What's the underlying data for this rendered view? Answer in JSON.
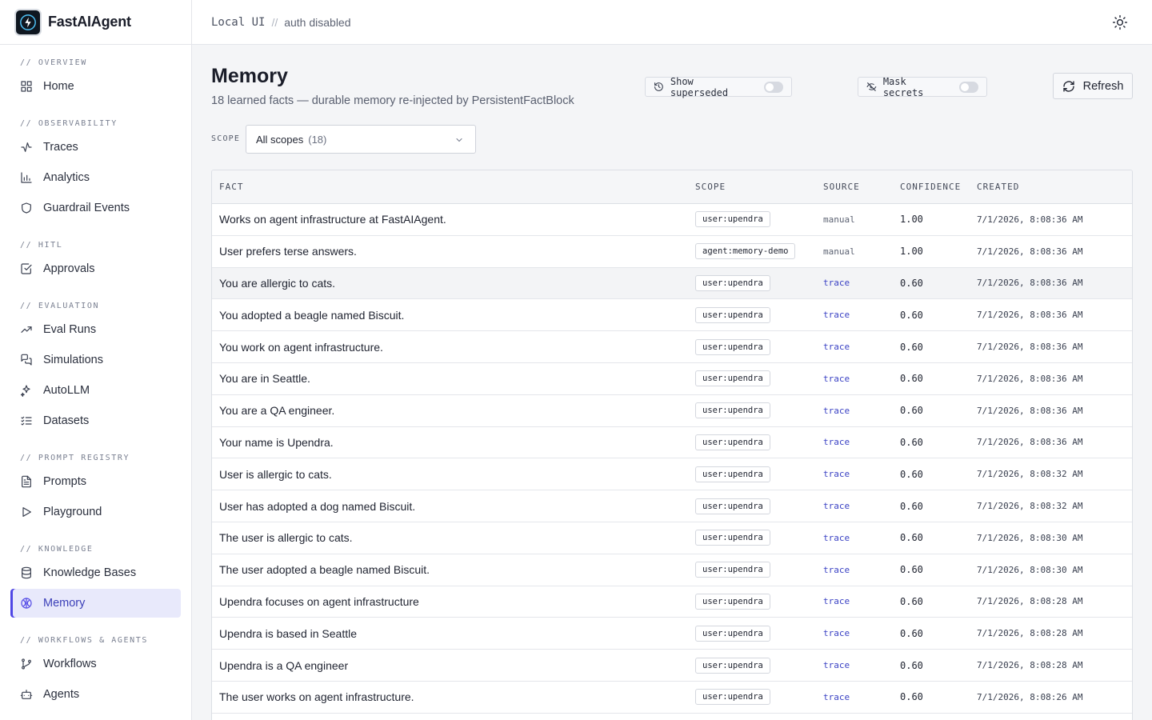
{
  "brand": {
    "name": "FastAIAgent"
  },
  "topbar": {
    "mode": "Local UI",
    "separator": "//",
    "auth": "auth disabled"
  },
  "nav": {
    "sections": [
      {
        "title": "// OVERVIEW",
        "items": [
          {
            "label": "Home",
            "icon": "home-grid-icon"
          }
        ]
      },
      {
        "title": "// OBSERVABILITY",
        "items": [
          {
            "label": "Traces",
            "icon": "activity-icon"
          },
          {
            "label": "Analytics",
            "icon": "bar-chart-icon"
          },
          {
            "label": "Guardrail Events",
            "icon": "shield-icon"
          }
        ]
      },
      {
        "title": "// HITL",
        "items": [
          {
            "label": "Approvals",
            "icon": "check-square-icon"
          }
        ]
      },
      {
        "title": "// EVALUATION",
        "items": [
          {
            "label": "Eval Runs",
            "icon": "trending-up-icon"
          },
          {
            "label": "Simulations",
            "icon": "chat-bubbles-icon"
          },
          {
            "label": "AutoLLM",
            "icon": "sparkles-icon"
          },
          {
            "label": "Datasets",
            "icon": "list-checks-icon"
          }
        ]
      },
      {
        "title": "// PROMPT REGISTRY",
        "items": [
          {
            "label": "Prompts",
            "icon": "file-text-icon"
          },
          {
            "label": "Playground",
            "icon": "play-icon"
          }
        ]
      },
      {
        "title": "// KNOWLEDGE",
        "items": [
          {
            "label": "Knowledge Bases",
            "icon": "database-icon"
          },
          {
            "label": "Memory",
            "icon": "brain-icon",
            "active": true
          }
        ]
      },
      {
        "title": "// WORKFLOWS & AGENTS",
        "items": [
          {
            "label": "Workflows",
            "icon": "git-branch-icon"
          },
          {
            "label": "Agents",
            "icon": "bot-icon"
          }
        ]
      }
    ]
  },
  "page": {
    "title": "Memory",
    "subtitle": "18 learned facts — durable memory re-injected by PersistentFactBlock",
    "show_superseded_label": "Show superseded",
    "show_superseded_on": false,
    "mask_secrets_label": "Mask secrets",
    "mask_secrets_on": false,
    "refresh_label": "Refresh",
    "scope_label": "SCOPE",
    "scope_value": "All scopes",
    "scope_count": "(18)"
  },
  "table": {
    "columns": {
      "fact": "FACT",
      "scope": "SCOPE",
      "source": "SOURCE",
      "confidence": "CONFIDENCE",
      "created": "CREATED"
    },
    "rows": [
      {
        "fact": "Works on agent infrastructure at FastAIAgent.",
        "scope": "user:upendra",
        "source": "manual",
        "confidence": "1.00",
        "created": "7/1/2026, 8:08:36 AM"
      },
      {
        "fact": "User prefers terse answers.",
        "scope": "agent:memory-demo",
        "source": "manual",
        "confidence": "1.00",
        "created": "7/1/2026, 8:08:36 AM"
      },
      {
        "fact": "You are allergic to cats.",
        "scope": "user:upendra",
        "source": "trace",
        "confidence": "0.60",
        "created": "7/1/2026, 8:08:36 AM"
      },
      {
        "fact": "You adopted a beagle named Biscuit.",
        "scope": "user:upendra",
        "source": "trace",
        "confidence": "0.60",
        "created": "7/1/2026, 8:08:36 AM"
      },
      {
        "fact": "You work on agent infrastructure.",
        "scope": "user:upendra",
        "source": "trace",
        "confidence": "0.60",
        "created": "7/1/2026, 8:08:36 AM"
      },
      {
        "fact": "You are in Seattle.",
        "scope": "user:upendra",
        "source": "trace",
        "confidence": "0.60",
        "created": "7/1/2026, 8:08:36 AM"
      },
      {
        "fact": "You are a QA engineer.",
        "scope": "user:upendra",
        "source": "trace",
        "confidence": "0.60",
        "created": "7/1/2026, 8:08:36 AM"
      },
      {
        "fact": "Your name is Upendra.",
        "scope": "user:upendra",
        "source": "trace",
        "confidence": "0.60",
        "created": "7/1/2026, 8:08:36 AM"
      },
      {
        "fact": "User is allergic to cats.",
        "scope": "user:upendra",
        "source": "trace",
        "confidence": "0.60",
        "created": "7/1/2026, 8:08:32 AM"
      },
      {
        "fact": "User has adopted a dog named Biscuit.",
        "scope": "user:upendra",
        "source": "trace",
        "confidence": "0.60",
        "created": "7/1/2026, 8:08:32 AM"
      },
      {
        "fact": "The user is allergic to cats.",
        "scope": "user:upendra",
        "source": "trace",
        "confidence": "0.60",
        "created": "7/1/2026, 8:08:30 AM"
      },
      {
        "fact": "The user adopted a beagle named Biscuit.",
        "scope": "user:upendra",
        "source": "trace",
        "confidence": "0.60",
        "created": "7/1/2026, 8:08:30 AM"
      },
      {
        "fact": "Upendra focuses on agent infrastructure",
        "scope": "user:upendra",
        "source": "trace",
        "confidence": "0.60",
        "created": "7/1/2026, 8:08:28 AM"
      },
      {
        "fact": "Upendra is based in Seattle",
        "scope": "user:upendra",
        "source": "trace",
        "confidence": "0.60",
        "created": "7/1/2026, 8:08:28 AM"
      },
      {
        "fact": "Upendra is a QA engineer",
        "scope": "user:upendra",
        "source": "trace",
        "confidence": "0.60",
        "created": "7/1/2026, 8:08:28 AM"
      },
      {
        "fact": "The user works on agent infrastructure.",
        "scope": "user:upendra",
        "source": "trace",
        "confidence": "0.60",
        "created": "7/1/2026, 8:08:26 AM"
      }
    ]
  },
  "colors": {
    "accent": "#4f46e5",
    "active_bg": "#e8e9fb",
    "trace_link": "#3b42c4"
  }
}
